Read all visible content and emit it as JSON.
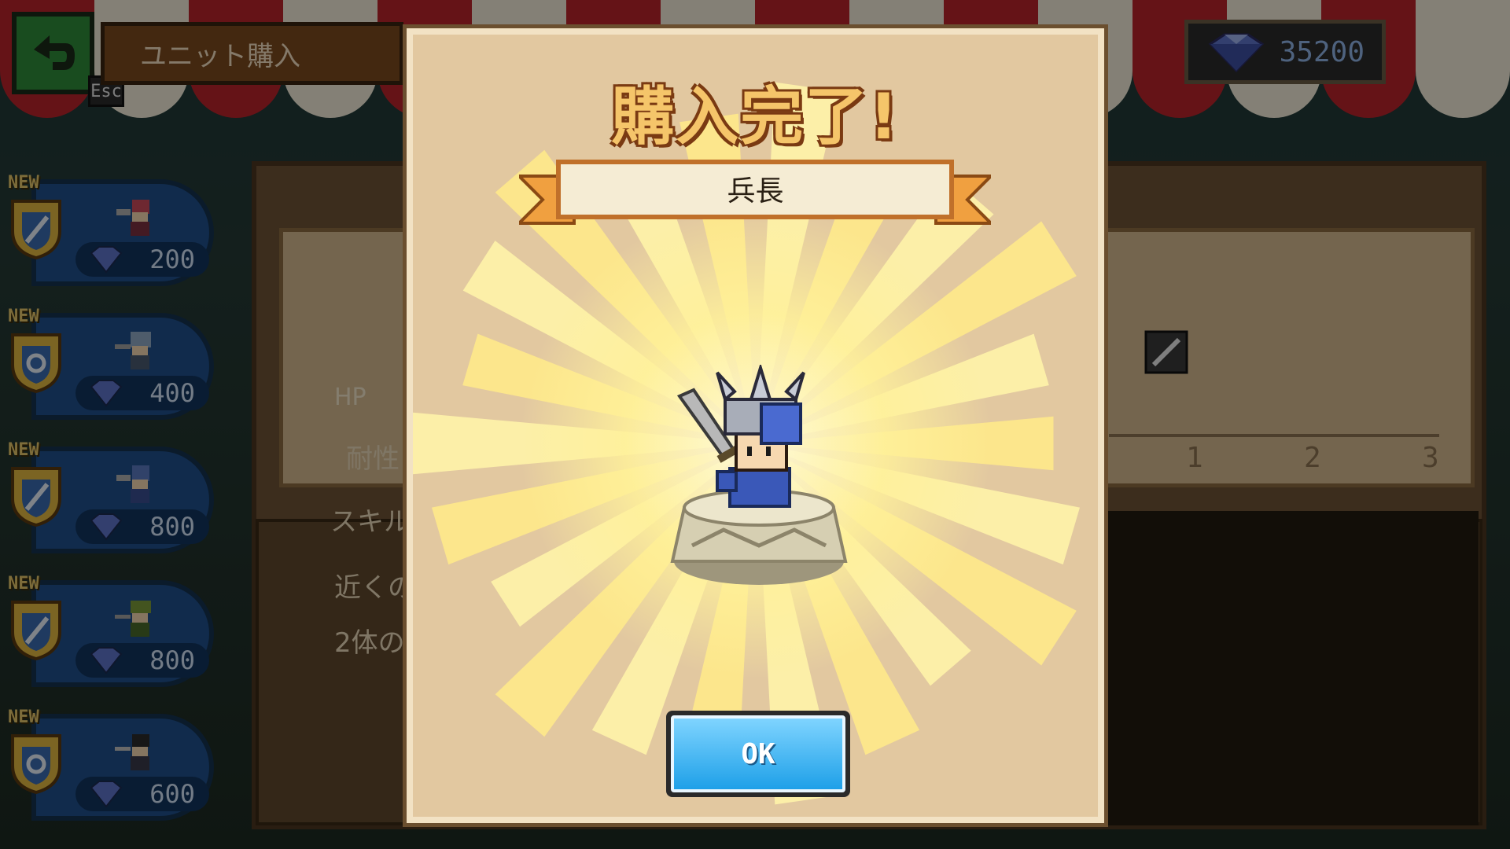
{
  "header": {
    "title": "ユニット購入",
    "esc_label": "Esc"
  },
  "currency": {
    "gems": "35200",
    "icon": "gem-icon"
  },
  "unit_list": [
    {
      "badge": "NEW",
      "price": "200"
    },
    {
      "badge": "NEW",
      "price": "400"
    },
    {
      "badge": "NEW",
      "price": "800"
    },
    {
      "badge": "NEW",
      "price": "800"
    },
    {
      "badge": "NEW",
      "price": "600"
    }
  ],
  "background_panel": {
    "hp_label": "HP",
    "resist_label": "耐性",
    "skill_header": "スキル",
    "skill_1": "近くの",
    "skill_2": "2体の",
    "stat_ticks": [
      "1",
      "2",
      "3"
    ]
  },
  "modal": {
    "title": "購入完了!",
    "unit_name": "兵長",
    "ok_label": "OK"
  },
  "colors": {
    "title": "#f5c56a",
    "ok_button": "#1ea0e8",
    "panel": "#e2c8a0"
  }
}
